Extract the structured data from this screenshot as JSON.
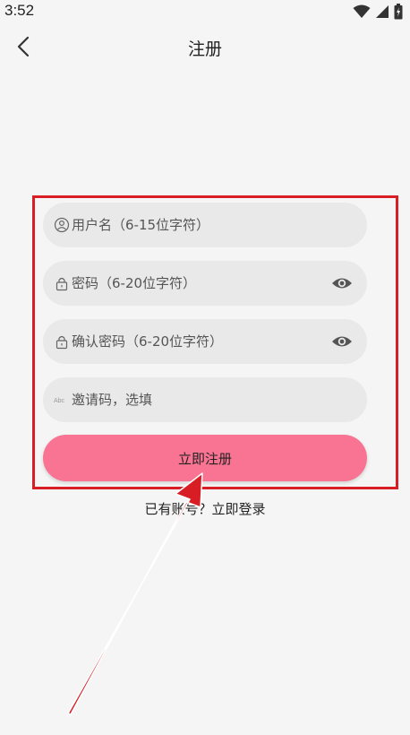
{
  "status_bar": {
    "time": "3:52",
    "icons": [
      "wifi-icon",
      "signal-icon",
      "battery-icon"
    ]
  },
  "header": {
    "back_icon": "chevron-left-icon",
    "title": "注册"
  },
  "form": {
    "username": {
      "placeholder": "用户名（6-15位字符）",
      "value": "",
      "icon": "user-icon"
    },
    "password": {
      "placeholder": "密码（6-20位字符）",
      "value": "",
      "icon": "lock-icon",
      "toggle_icon": "eye-icon"
    },
    "confirm_password": {
      "placeholder": "确认密码（6-20位字符）",
      "value": "",
      "icon": "lock-icon",
      "toggle_icon": "eye-icon"
    },
    "invite_code": {
      "placeholder": "邀请码，选填",
      "value": "",
      "icon": "abc-icon",
      "icon_text": "Abc"
    },
    "submit_label": "立即注册"
  },
  "footer": {
    "prompt": "已有账号？",
    "login_link": "立即登录"
  },
  "colors": {
    "background": "#f5f5f5",
    "field_background": "#e9e9e9",
    "accent": "#f97393",
    "annotation": "#d81e24"
  }
}
